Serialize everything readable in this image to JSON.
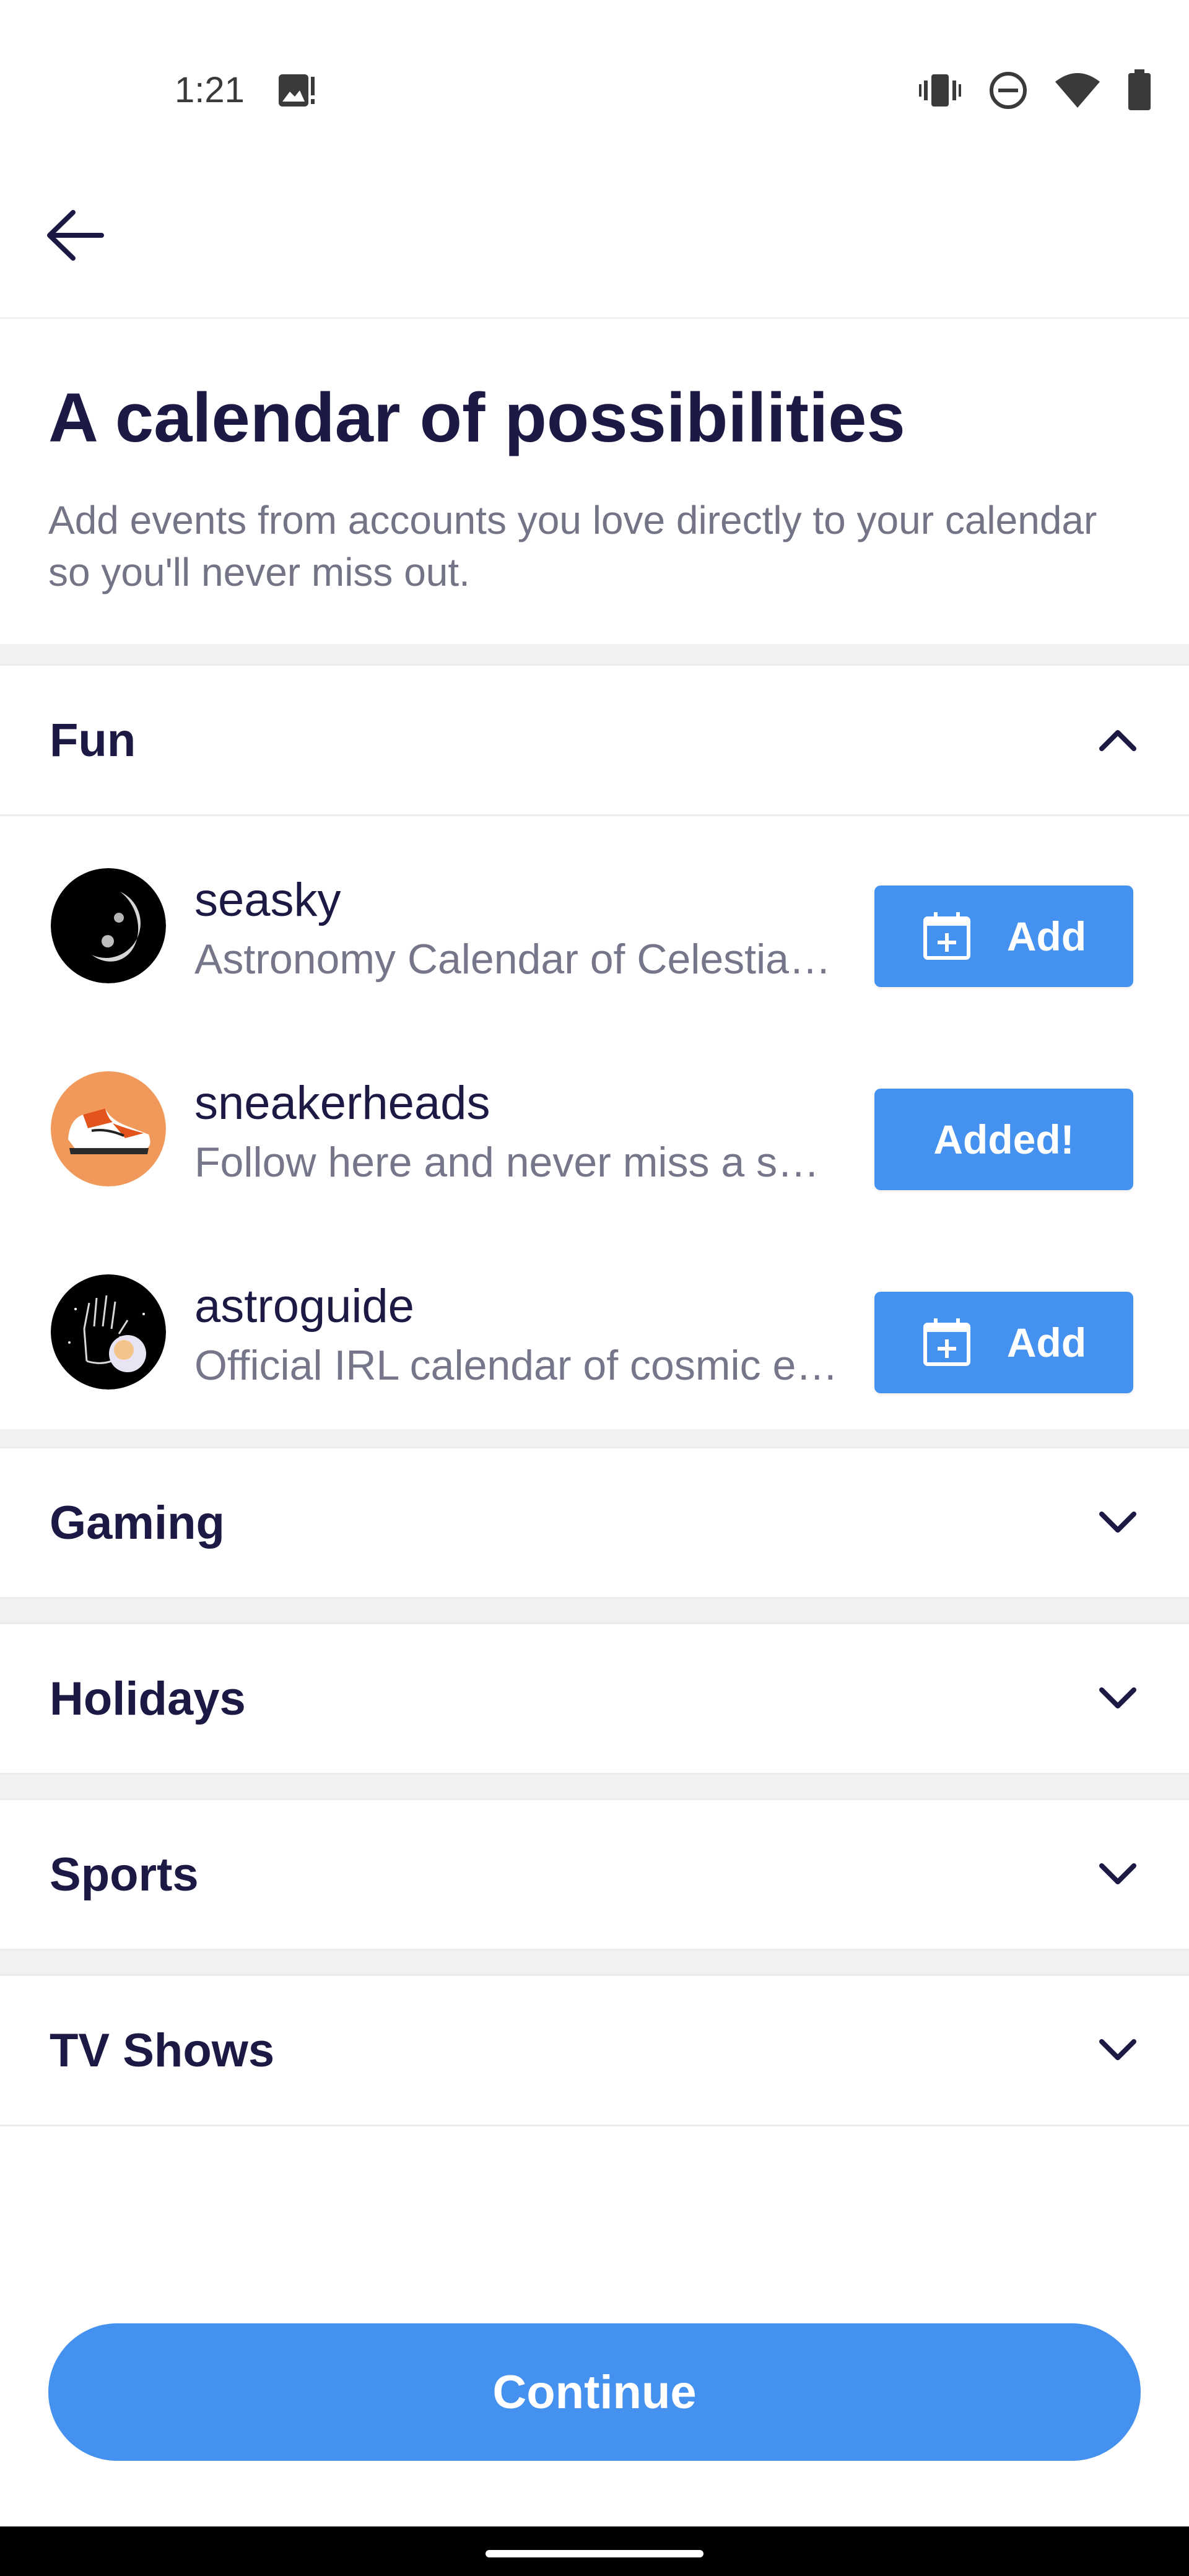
{
  "status_bar": {
    "time": "1:21",
    "icons": [
      "image-alert-icon",
      "vibrate-icon",
      "do-not-disturb-icon",
      "wifi-icon",
      "battery-icon"
    ]
  },
  "header": {
    "back_icon": "arrow-left-icon"
  },
  "intro": {
    "title": "A calendar of possibilities",
    "subtitle": "Add events from accounts you love directly to your calendar so you'll never miss out."
  },
  "sections": [
    {
      "label": "Fun",
      "expanded": true
    },
    {
      "label": "Gaming",
      "expanded": false
    },
    {
      "label": "Holidays",
      "expanded": false
    },
    {
      "label": "Sports",
      "expanded": false
    },
    {
      "label": "TV Shows",
      "expanded": false
    }
  ],
  "accounts": [
    {
      "name": "seasky",
      "description": "Astronomy Calendar of Celestial Events",
      "button_label": "Add",
      "added": false
    },
    {
      "name": "sneakerheads",
      "description": "Follow here and never miss a sneaker drop",
      "button_label": "Added!",
      "added": true
    },
    {
      "name": "astroguide",
      "description": "Official IRL calendar of cosmic events",
      "button_label": "Add",
      "added": false
    }
  ],
  "continue_label": "Continue",
  "colors": {
    "accent": "#4591f0",
    "title": "#1c1a45",
    "muted": "#76768a",
    "band": "#f1f1f3"
  }
}
